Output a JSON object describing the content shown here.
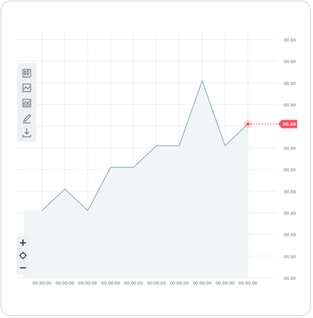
{
  "chart_data": {
    "type": "area",
    "y_tick_labels": [
      "00.00",
      "00.00",
      "00.00",
      "00.00",
      "00.00",
      "00.00",
      "00.00",
      "00.00",
      "00.00",
      "00.00",
      "00.00",
      "00.00"
    ],
    "x_tick_labels": [
      "00:00:00",
      "00:00:00",
      "00:00:00",
      "00:00:00",
      "00:00:00",
      "00:00:00",
      "00:00:00",
      "00:00:00",
      "00:00:00",
      "00:00:00"
    ],
    "series": [
      {
        "values": [
          [
            0.3,
            3.1
          ],
          [
            1.3,
            4.1
          ],
          [
            2.3,
            3.1
          ],
          [
            3.3,
            5.1
          ],
          [
            4.3,
            5.1
          ],
          [
            5.3,
            6.1
          ],
          [
            6.3,
            6.1
          ],
          [
            7.3,
            9.1
          ],
          [
            8.3,
            6.1
          ],
          [
            9.3,
            7.1
          ]
        ]
      }
    ],
    "xlim": [
      -0.5,
      10.2
    ],
    "ylim": [
      0,
      11
    ],
    "grid": true,
    "current_value_label": "00.00",
    "colors": {
      "line": "#8fb0b8",
      "fill": "#eef3f5",
      "marker": "#ff4d5e",
      "grid": "#eef0f2",
      "text": "#5f6b73"
    }
  },
  "toolbar": {
    "icons": [
      "candlestick-chart-icon",
      "line-chart-icon",
      "area-chart-icon",
      "pencil-draw-icon",
      "download-icon"
    ]
  },
  "zoom": {
    "zoom_in_label": "+",
    "zoom_out_label": "−",
    "reset_icon": "target-reset-icon"
  }
}
